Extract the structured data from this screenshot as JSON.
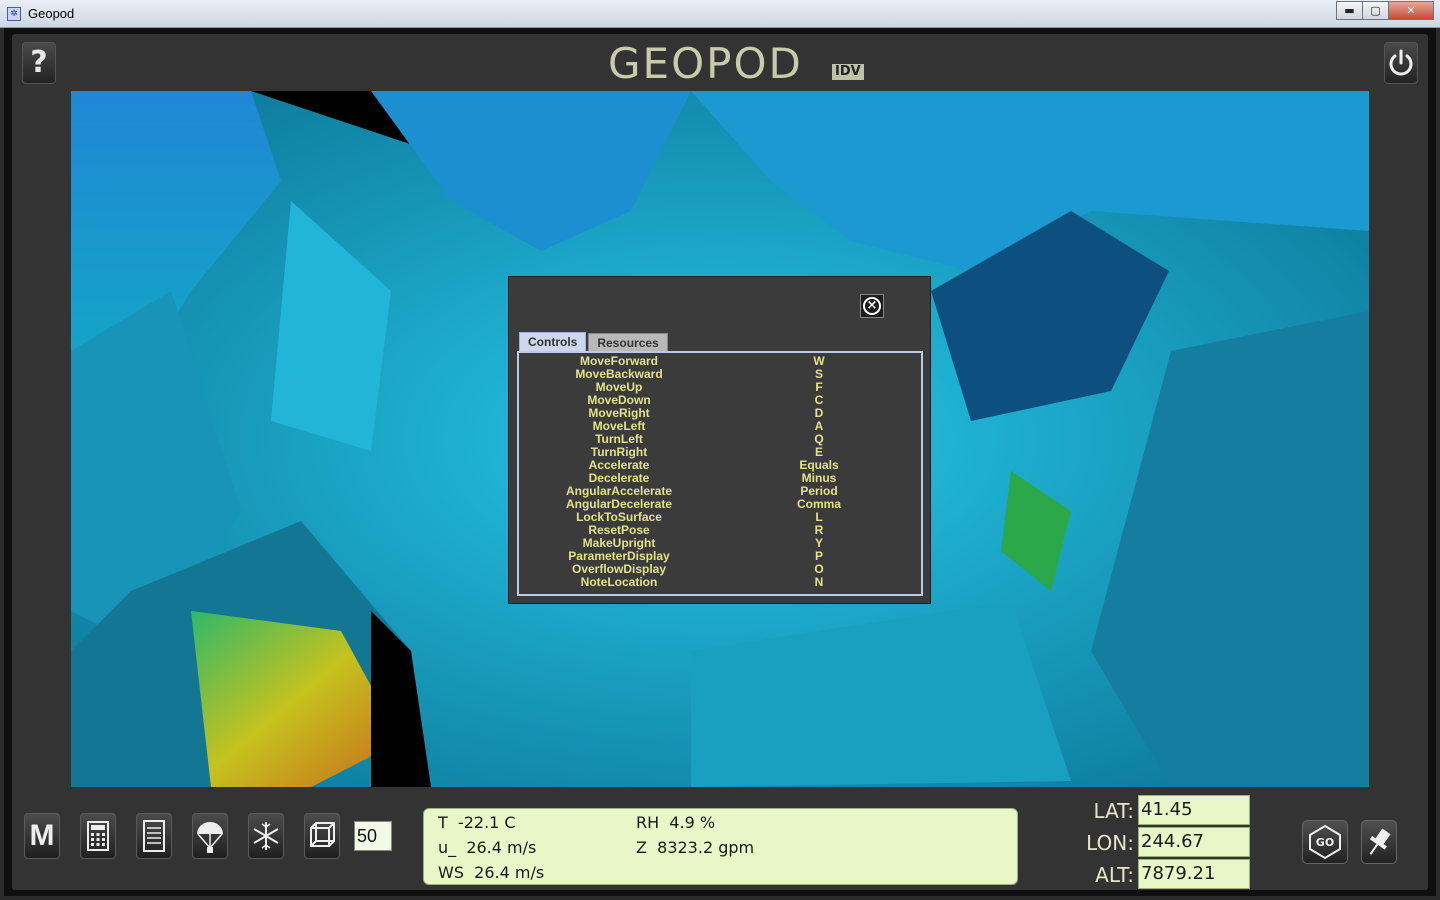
{
  "window": {
    "title": "Geopod",
    "minimize": "▬",
    "maximize": "▢",
    "close": "✕"
  },
  "header": {
    "logo": "GEOPOD",
    "logo_badge": "IDV",
    "help_label": "?"
  },
  "dialog": {
    "close_glyph": "×",
    "tabs": [
      {
        "label": "Controls",
        "active": true
      },
      {
        "label": "Resources",
        "active": false
      }
    ],
    "controls": [
      {
        "action": "MoveForward",
        "key": "W"
      },
      {
        "action": "MoveBackward",
        "key": "S"
      },
      {
        "action": "MoveUp",
        "key": "F"
      },
      {
        "action": "MoveDown",
        "key": "C"
      },
      {
        "action": "MoveRight",
        "key": "D"
      },
      {
        "action": "MoveLeft",
        "key": "A"
      },
      {
        "action": "TurnLeft",
        "key": "Q"
      },
      {
        "action": "TurnRight",
        "key": "E"
      },
      {
        "action": "Accelerate",
        "key": "Equals"
      },
      {
        "action": "Decelerate",
        "key": "Minus"
      },
      {
        "action": "AngularAccelerate",
        "key": "Period"
      },
      {
        "action": "AngularDecelerate",
        "key": "Comma"
      },
      {
        "action": "LockToSurface",
        "key": "L"
      },
      {
        "action": "ResetPose",
        "key": "R"
      },
      {
        "action": "MakeUpright",
        "key": "Y"
      },
      {
        "action": "ParameterDisplay",
        "key": "P"
      },
      {
        "action": "OverflowDisplay",
        "key": "O"
      },
      {
        "action": "NoteLocation",
        "key": "N"
      }
    ]
  },
  "toolbar": {
    "m_label": "M",
    "icons": [
      "calculator-icon",
      "notepad-icon",
      "parachute-icon",
      "snowflake-icon",
      "cube-icon"
    ],
    "step_value": "50"
  },
  "readout": {
    "t": "T  -22.1 C",
    "u": "u_  26.4 m/s",
    "ws": "WS  26.4 m/s",
    "rh": "RH  4.9 %",
    "z": "Z  8323.2 gpm"
  },
  "coords": {
    "lat_label": "LAT:",
    "lat": "41.45",
    "lon_label": "LON:",
    "lon": "244.67",
    "alt_label": "ALT:",
    "alt": "7879.21"
  },
  "go_label": "GO",
  "colors": {
    "accent": "#e2e28a",
    "panel": "#3b3b3b",
    "readout_bg": "#e9f7c8",
    "surface": "#1aa8c8"
  }
}
